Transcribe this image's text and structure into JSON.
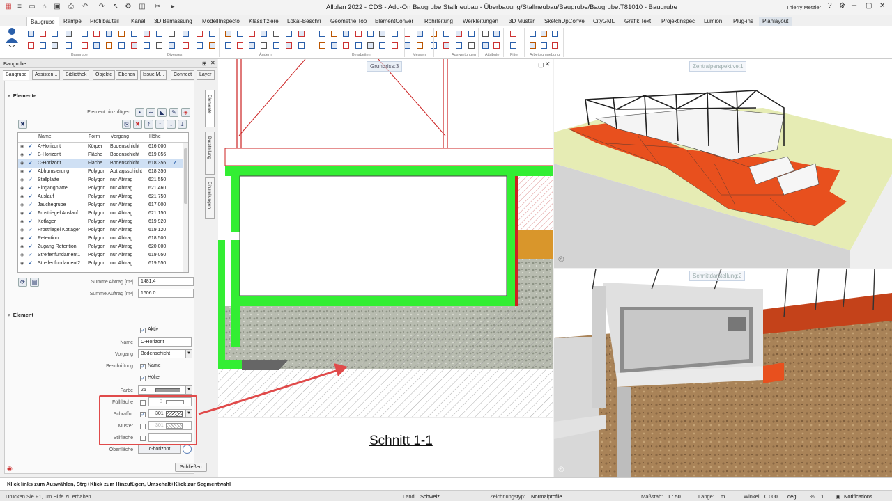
{
  "app": {
    "title": "Allplan 2022 - CDS - Add-On Baugrube Stallneubau - Überbauung/Stallneubau/Baugrube/Baugrube:T81010 - Baugrube",
    "user": "Thierry Metzler"
  },
  "ribbon": {
    "tabs": [
      "Baugrube",
      "Rampe",
      "Profilbauteil",
      "Kanal",
      "3D Bemassung",
      "ModellInspecto",
      "Klassifiziere",
      "Lokal-Beschri",
      "Geometrie Too",
      "ElementConver",
      "Rohrleitung",
      "Werkleitungen",
      "3D Muster",
      "SketchUpConve",
      "CityGML",
      "Grafik Text",
      "Projektinspec",
      "Lumion",
      "Plug-ins",
      "Planlayout"
    ],
    "active_tab": "Baugrube",
    "groups": [
      "Baugrube",
      "Diverses",
      "Ändern",
      "Bearbeiten",
      "Messen",
      "Auswertungen",
      "Attribute",
      "Filter",
      "Arbeitsumgebung"
    ]
  },
  "panel": {
    "title": "Baugrube",
    "tabs": [
      "Baugrube",
      "Assisten...",
      "Bibliothek",
      "Objekte",
      "Ebenen",
      "Issue M...",
      "Connect",
      "Layer"
    ],
    "active_tab": "Baugrube",
    "side_tabs": [
      "Elemente",
      "Darstellung",
      "Einstellungen"
    ],
    "elements": {
      "section_title": "Elemente",
      "add_label": "Element hinzufügen",
      "columns": [
        "Name",
        "Form",
        "Vorgang",
        "Höhe"
      ],
      "rows": [
        {
          "name": "A-Horizont",
          "form": "Körper",
          "vorgang": "Bodenschicht",
          "hoehe": "616.000",
          "selected": false
        },
        {
          "name": "B-Horizont",
          "form": "Fläche",
          "vorgang": "Bodenschicht",
          "hoehe": "619.056",
          "selected": false
        },
        {
          "name": "C-Horizont",
          "form": "Fläche",
          "vorgang": "Bodenschicht",
          "hoehe": "618.356",
          "selected": true
        },
        {
          "name": "Abhumsierung",
          "form": "Polygon",
          "vorgang": "Abtragsschicht",
          "hoehe": "618.356",
          "selected": false
        },
        {
          "name": "Stallplatte",
          "form": "Polygon",
          "vorgang": "nur Abtrag",
          "hoehe": "621.550",
          "selected": false
        },
        {
          "name": "Eingangplatte",
          "form": "Polygon",
          "vorgang": "nur Abtrag",
          "hoehe": "621.460",
          "selected": false
        },
        {
          "name": "Auslauf",
          "form": "Polygon",
          "vorgang": "nur Abtrag",
          "hoehe": "621.750",
          "selected": false
        },
        {
          "name": "Jauchegrube",
          "form": "Polygon",
          "vorgang": "nur Abtrag",
          "hoehe": "617.000",
          "selected": false
        },
        {
          "name": "Frostriegel Auslauf",
          "form": "Polygon",
          "vorgang": "nur Abtrag",
          "hoehe": "621.150",
          "selected": false
        },
        {
          "name": "Kotlager",
          "form": "Polygon",
          "vorgang": "nur Abtrag",
          "hoehe": "619.920",
          "selected": false
        },
        {
          "name": "Frostriegel Kotlager",
          "form": "Polygon",
          "vorgang": "nur Abtrag",
          "hoehe": "619.120",
          "selected": false
        },
        {
          "name": "Retention",
          "form": "Polygon",
          "vorgang": "nur Abtrag",
          "hoehe": "618.500",
          "selected": false
        },
        {
          "name": "Zugang Retention",
          "form": "Polygon",
          "vorgang": "nur Abtrag",
          "hoehe": "620.000",
          "selected": false
        },
        {
          "name": "Streifenfundament1",
          "form": "Polygon",
          "vorgang": "nur Abtrag",
          "hoehe": "619.050",
          "selected": false
        },
        {
          "name": "Streifenfundament2",
          "form": "Polygon",
          "vorgang": "nur Abtrag",
          "hoehe": "619.550",
          "selected": false
        }
      ],
      "summe_abtrag_label": "Summe Abtrag [m³]",
      "summe_abtrag": "1481.4",
      "summe_auftrag_label": "Summe Auftrag [m³]",
      "summe_auftrag": "1606.0"
    },
    "element": {
      "section_title": "Element",
      "aktiv_label": "Aktiv",
      "name_label": "Name",
      "name_value": "C-Horizont",
      "vorgang_label": "Vorgang",
      "vorgang_value": "Bodenschicht",
      "beschriftung_label": "Beschriftung",
      "beschriftung_name": "Name",
      "beschriftung_hoehe": "Höhe",
      "farbe_label": "Farbe",
      "farbe_value": "25",
      "fuellflaeche_label": "Füllfläche",
      "fuellflaeche_value": "0",
      "schraffur_label": "Schraffur",
      "schraffur_value": "301",
      "muster_label": "Muster",
      "muster_value": "301",
      "stilflaeche_label": "Stilfläche",
      "oberflaeche_label": "Oberfläche",
      "oberflaeche_value": "c-horizont"
    },
    "close_button": "Schließen"
  },
  "views": {
    "grundriss_label": "Grundriss:3",
    "zentral_label": "Zentralperspektive:1",
    "schnitt_label": "Schnittdarstellung:2",
    "section_title": "Schnitt 1-1"
  },
  "status": {
    "hint": "Klick links zum Auswählen, Strg+Klick zum Hinzufügen, Umschalt+Klick zur Segmentwahl",
    "help": "Drücken Sie F1, um Hilfe zu erhalten.",
    "land_label": "Land:",
    "land_value": "Schweiz",
    "zeichnungstyp_label": "Zeichnungstyp:",
    "zeichnungstyp_value": "Normalprofile",
    "massstab_label": "Maßstab:",
    "massstab_value": "1 : 50",
    "laenge_label": "Länge:",
    "laenge_value": "m",
    "winkel_label": "Winkel:",
    "winkel_value": "0.000",
    "winkel_unit": "deg",
    "percent_label": "%",
    "percent_value": "1",
    "notifications": "Notifications"
  },
  "colors": {
    "accent": "#2a5faa",
    "highlight_red": "#e04a4a",
    "wall_green": "#33ee33",
    "soil_red": "#e8501e"
  }
}
